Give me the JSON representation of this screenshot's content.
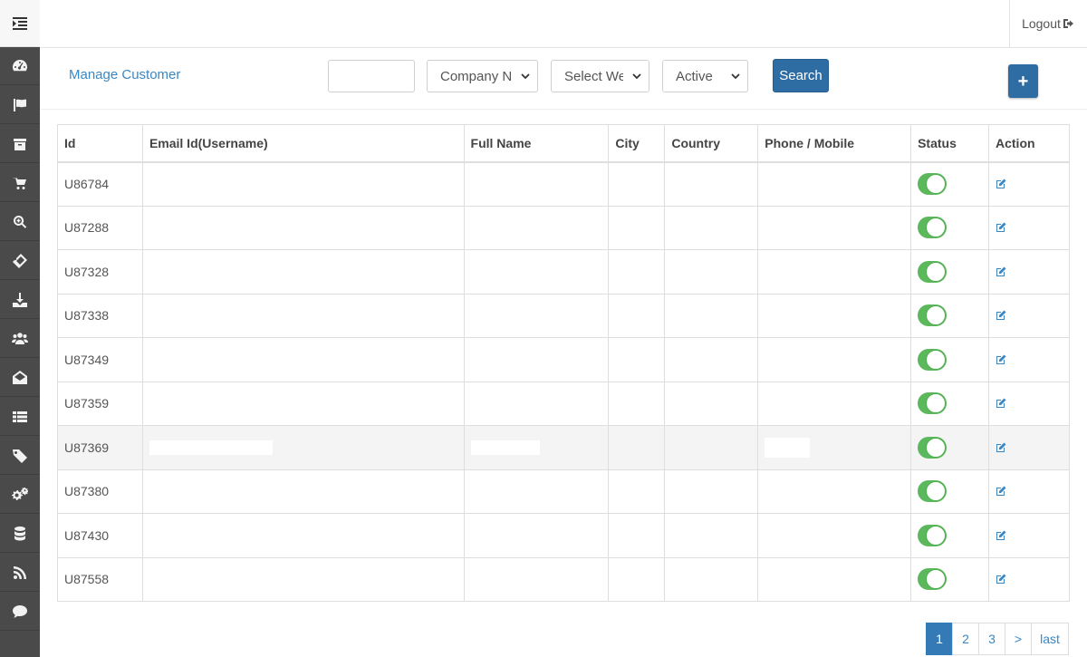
{
  "topbar": {
    "logout_label": "Logout"
  },
  "sidebar": {
    "items": [
      {
        "icon": "dashboard-icon"
      },
      {
        "icon": "flag-icon"
      },
      {
        "icon": "archive-icon"
      },
      {
        "icon": "cart-icon"
      },
      {
        "icon": "search-plus-icon"
      },
      {
        "icon": "ticket-icon"
      },
      {
        "icon": "download-icon"
      },
      {
        "icon": "users-icon"
      },
      {
        "icon": "envelope-open-icon"
      },
      {
        "icon": "list-icon"
      },
      {
        "icon": "tags-icon"
      },
      {
        "icon": "gears-icon"
      },
      {
        "icon": "database-icon"
      },
      {
        "icon": "rss-icon"
      },
      {
        "icon": "comment-icon"
      }
    ]
  },
  "page": {
    "title": "Manage Customer"
  },
  "filters": {
    "search_value": "",
    "company": "Company Nan",
    "website": "Select Webs",
    "status": "Active",
    "search_button": "Search",
    "add_button": "+"
  },
  "table": {
    "columns": [
      "Id",
      "Email Id(Username)",
      "Full Name",
      "City",
      "Country",
      "Phone / Mobile",
      "Status",
      "Action"
    ],
    "rows": [
      {
        "id": "U86784",
        "status_on": true
      },
      {
        "id": "U87288",
        "status_on": true
      },
      {
        "id": "U87328",
        "status_on": true
      },
      {
        "id": "U87338",
        "status_on": true
      },
      {
        "id": "U87349",
        "status_on": true
      },
      {
        "id": "U87359",
        "status_on": true
      },
      {
        "id": "U87369",
        "status_on": true
      },
      {
        "id": "U87380",
        "status_on": true
      },
      {
        "id": "U87430",
        "status_on": true
      },
      {
        "id": "U87558",
        "status_on": true
      }
    ]
  },
  "pagination": {
    "pages": [
      "1",
      "2",
      "3",
      ">",
      "last"
    ],
    "active": "1"
  },
  "colors": {
    "primary": "#2e6da4",
    "link": "#3a87c4",
    "toggle_on": "#5cb85c",
    "sidebar": "#4a4a4a"
  }
}
